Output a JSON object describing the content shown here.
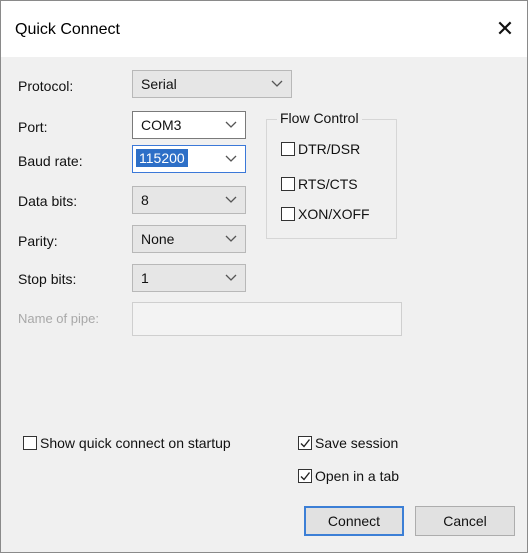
{
  "window": {
    "title": "Quick Connect"
  },
  "labels": {
    "protocol": "Protocol:",
    "port": "Port:",
    "baud_rate": "Baud rate:",
    "data_bits": "Data bits:",
    "parity": "Parity:",
    "stop_bits": "Stop bits:",
    "name_of_pipe": "Name of pipe:"
  },
  "fields": {
    "protocol": "Serial",
    "port": "COM3",
    "baud_rate": "115200",
    "data_bits": "8",
    "parity": "None",
    "stop_bits": "1",
    "name_of_pipe": ""
  },
  "flow_control": {
    "title": "Flow Control",
    "options": [
      {
        "label": "DTR/DSR",
        "checked": false
      },
      {
        "label": "RTS/CTS",
        "checked": false
      },
      {
        "label": "XON/XOFF",
        "checked": false
      }
    ]
  },
  "options": {
    "show_on_startup": {
      "label": "Show quick connect on startup",
      "checked": false
    },
    "save_session": {
      "label": "Save session",
      "checked": true
    },
    "open_in_tab": {
      "label": "Open in a tab",
      "checked": true
    }
  },
  "buttons": {
    "connect": "Connect",
    "cancel": "Cancel"
  },
  "icons": {
    "close": "close-icon",
    "dropdown": "chevron-down-icon",
    "check": "checkmark-icon"
  },
  "colors": {
    "focus": "#3b78d8",
    "selection": "#2d6fc7"
  }
}
